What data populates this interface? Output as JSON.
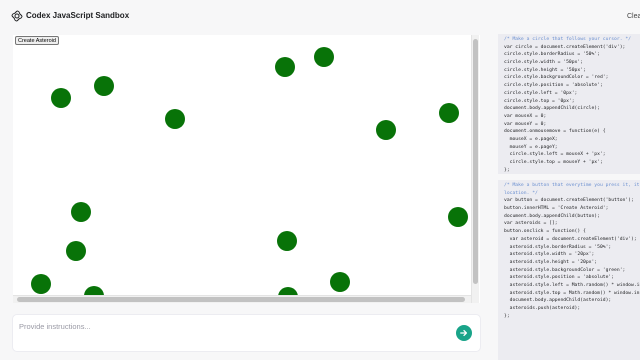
{
  "header": {
    "title": "Codex JavaScript Sandbox",
    "clear_label": "Clear"
  },
  "stage": {
    "create_button_label": "Create Asteroid",
    "asteroid_color": "#087308",
    "asteroid_count": 19
  },
  "prompt": {
    "placeholder": "Provide instructions...",
    "value": ""
  },
  "colors": {
    "accent": "#19a489",
    "code_background": "#ececf1",
    "asteroid": "#087308"
  },
  "code_blocks": [
    {
      "lines": [
        "/* Make a circle that follows your cursor. */",
        "var circle = document.createElement('div');",
        "circle.style.borderRadius = '50%';",
        "circle.style.width = '50px';",
        "circle.style.height = '50px';",
        "circle.style.backgroundColor = 'red';",
        "circle.style.position = 'absolute';",
        "circle.style.left = '0px';",
        "circle.style.top = '0px';",
        "document.body.appendChild(circle);",
        "var mouseX = 0;",
        "var mouseY = 0;",
        "document.onmousemove = function(e) {",
        "  mouseX = e.pageX;",
        "  mouseY = e.pageY;",
        "  circle.style.left = mouseX + 'px';",
        "  circle.style.top = mouseY + 'px';",
        "};"
      ]
    },
    {
      "lines": [
        "/* Make a button that everytime you press it, it",
        "location. */",
        "var button = document.createElement('button');",
        "button.innerHTML = 'Create Asteroid';",
        "document.body.appendChild(button);",
        "var asteroids = [];",
        "button.onclick = function() {",
        "  var asteroid = document.createElement('div');",
        "  asteroid.style.borderRadius = '50%';",
        "  asteroid.style.width = '20px';",
        "  asteroid.style.height = '20px';",
        "  asteroid.style.backgroundColor = 'green';",
        "  asteroid.style.position = 'absolute';",
        "  asteroid.style.left = Math.random() * window.in",
        "  asteroid.style.top = Math.random() * window.inn",
        "  document.body.appendChild(asteroid);",
        "  asteroids.push(asteroid);",
        "};"
      ]
    }
  ]
}
